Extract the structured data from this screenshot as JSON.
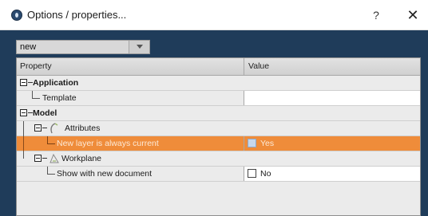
{
  "window": {
    "title": "Options / properties...",
    "help_label": "?",
    "close_label": "✕"
  },
  "dropdown": {
    "value": "new"
  },
  "grid": {
    "columns": {
      "property": "Property",
      "value": "Value"
    },
    "rows": [
      {
        "label": "Application"
      },
      {
        "label": "Template",
        "value": ""
      },
      {
        "label": "Model"
      },
      {
        "label": "Attributes"
      },
      {
        "label": "New layer is always current",
        "value": "Yes",
        "checked": true,
        "selected": true
      },
      {
        "label": "Workplane"
      },
      {
        "label": "Show with new document",
        "value": "No",
        "checked": false
      }
    ]
  },
  "colors": {
    "selection": "#ef8c3a",
    "background": "#1f3c5a"
  }
}
